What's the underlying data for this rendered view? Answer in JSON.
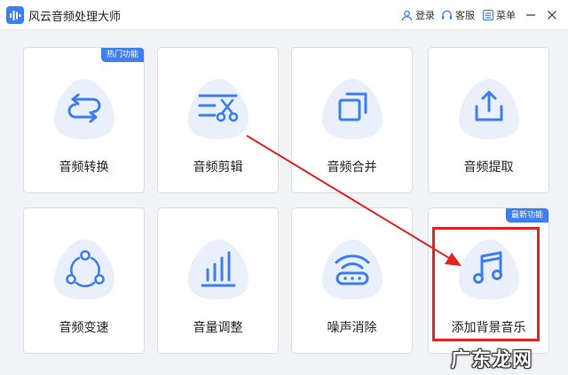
{
  "app": {
    "title": "风云音频处理大师"
  },
  "toolbar": {
    "login_label": "登录",
    "service_label": "客服",
    "menu_label": "菜单"
  },
  "cards": [
    {
      "label": "音频转换",
      "icon": "swap-arrows-icon",
      "badge": "热门功能"
    },
    {
      "label": "音频剪辑",
      "icon": "scissors-icon"
    },
    {
      "label": "音频合并",
      "icon": "merge-windows-icon"
    },
    {
      "label": "音频提取",
      "icon": "upload-tray-icon"
    },
    {
      "label": "音频变速",
      "icon": "share-nodes-icon"
    },
    {
      "label": "音量调整",
      "icon": "volume-bars-icon"
    },
    {
      "label": "噪声消除",
      "icon": "wifi-router-icon"
    },
    {
      "label": "添加背景音乐",
      "icon": "music-note-icon",
      "badge": "最新功能"
    }
  ],
  "annotation": {
    "highlight_color": "#e02424"
  },
  "watermark": "广东龙网",
  "colors": {
    "accent": "#3d7ef0",
    "icon_blob": "#e9f0fb",
    "background": "#f1f3f7"
  }
}
